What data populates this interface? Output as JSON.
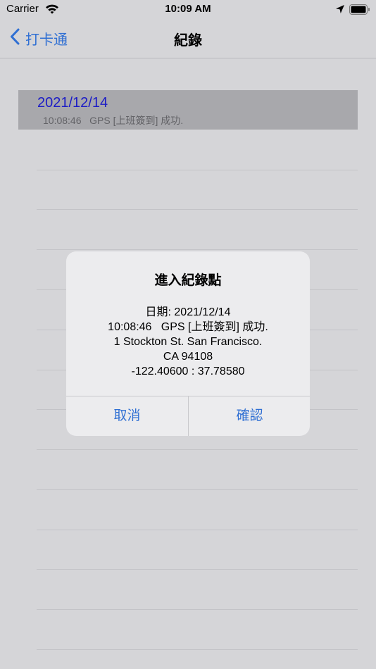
{
  "status_bar": {
    "carrier": "Carrier",
    "time": "10:09 AM",
    "icons": [
      "wifi-icon",
      "location-arrow-icon",
      "battery-icon"
    ]
  },
  "nav": {
    "back_label": "打卡通",
    "title": "紀錄"
  },
  "records": [
    {
      "date": "2021/12/14",
      "detail": "10:08:46   GPS [上班簽到] 成功."
    }
  ],
  "alert": {
    "title": "進入紀錄點",
    "message_lines": [
      "日期: 2021/12/14",
      "10:08:46   GPS [上班簽到] 成功.",
      "1 Stockton St. San Francisco.",
      "CA 94108",
      "-122.40600 : 37.78580"
    ],
    "cancel_label": "取消",
    "confirm_label": "確認"
  },
  "colors": {
    "accent": "#2f6fd3",
    "record_date": "#1c1cc6",
    "highlight_row": "#a8a8ac",
    "background": "#d5d5d8"
  }
}
